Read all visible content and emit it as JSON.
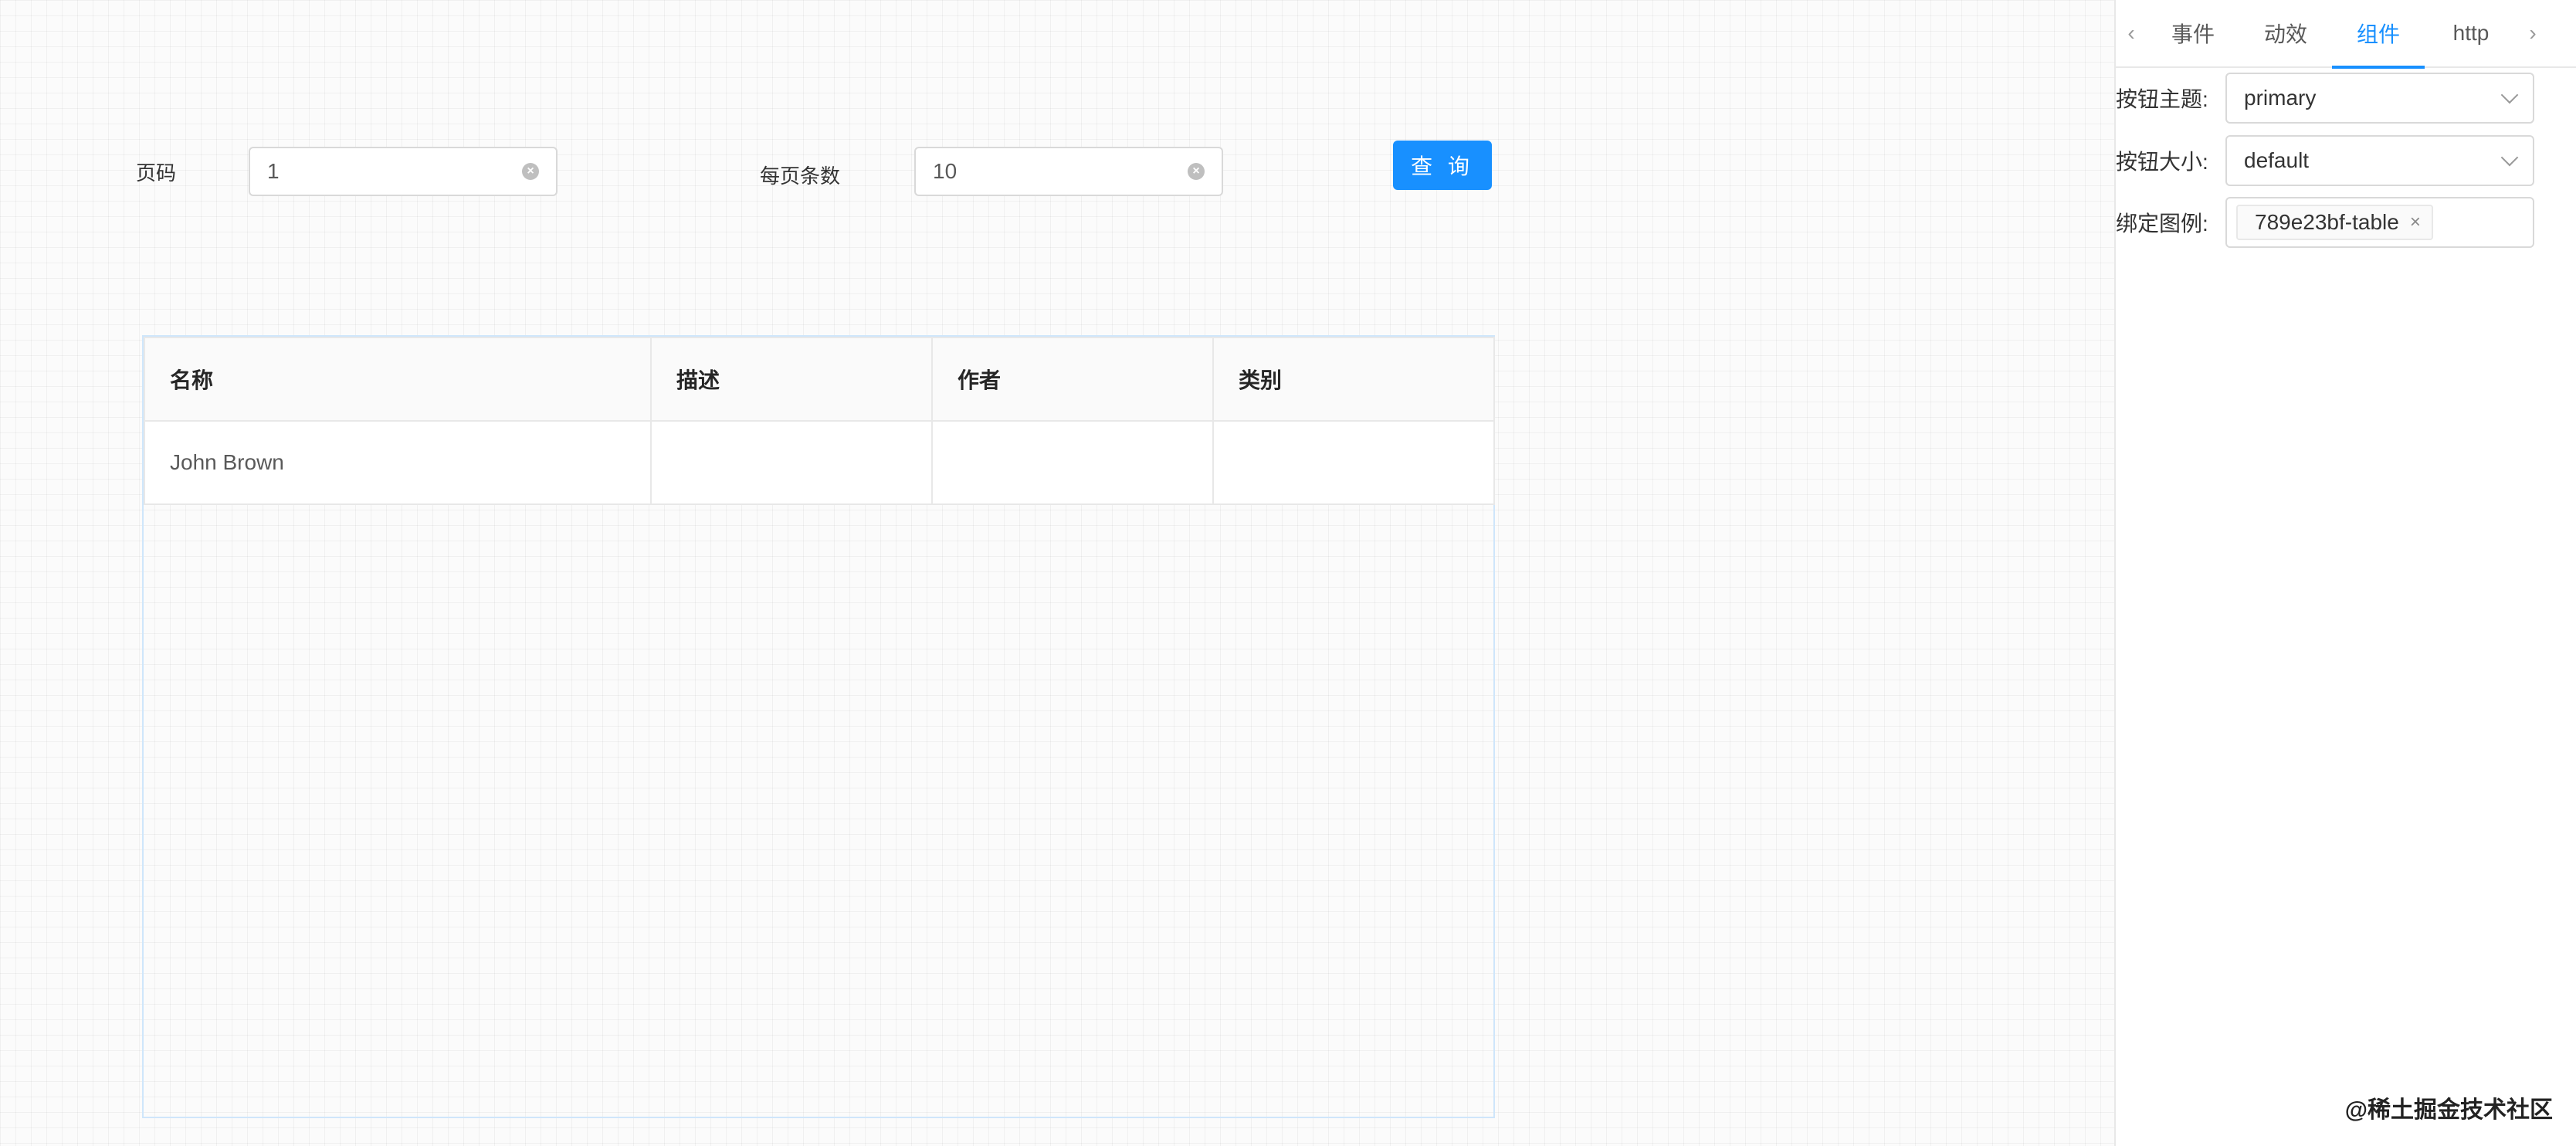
{
  "form": {
    "page_label": "页码",
    "page_value": "1",
    "size_label": "每页条数",
    "size_value": "10",
    "query_label": "查 询"
  },
  "table": {
    "columns": [
      "名称",
      "描述",
      "作者",
      "类别"
    ],
    "rows": [
      [
        "John Brown",
        "",
        "",
        ""
      ]
    ]
  },
  "panel": {
    "tabs": [
      {
        "label": "事件",
        "active": false
      },
      {
        "label": "动效",
        "active": false
      },
      {
        "label": "组件",
        "active": true
      },
      {
        "label": "http",
        "active": false
      }
    ],
    "props": {
      "theme_label": "按钮主题:",
      "theme_value": "primary",
      "size_label": "按钮大小:",
      "size_value": "default",
      "bind_label": "绑定图例:",
      "bind_tag": "789e23bf-table"
    }
  },
  "watermark": "@稀土掘金技术社区",
  "colors": {
    "accent": "#1890ff"
  }
}
